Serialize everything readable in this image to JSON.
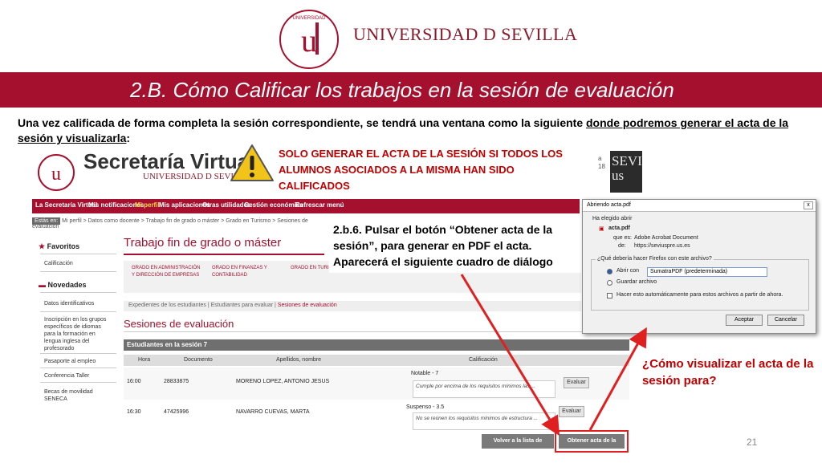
{
  "header": {
    "university_name": "UNIVERSIDAD D SEVILLA",
    "title": "2.B. Cómo Calificar los trabajos en la sesión de evaluación"
  },
  "intro": {
    "part1": "Una vez calificada de forma completa la sesión correspondiente, se tendrá una ventana como la siguiente ",
    "part2": "donde podremos generar el acta de la sesión y visualizarla",
    "part3": ":"
  },
  "secretaria": {
    "title": "Secretaría Virtual",
    "subtitle": "UNIVERSIDAD D SEVILLA"
  },
  "warning": {
    "text": "SOLO GENERAR EL ACTA DE LA SESIÓN SI TODOS LOS ALUMNOS ASOCIADOS A LA MISMA HAN SIDO CALIFICADOS"
  },
  "sevi": {
    "line1": "SEVI",
    "line2": "us",
    "side1": "a",
    "side2": "18"
  },
  "nav": {
    "items": [
      "La Secretaría Virtual",
      "Mis notificaciones",
      "Mi perfil",
      "Mis aplicaciones",
      "Otras utilidades",
      "Gestión económica",
      "Refrescar menú"
    ]
  },
  "breadcrumb": {
    "here": "Estás en:",
    "path": "Mi perfil > Datos como docente > Trabajo fin de grado o máster > Grado en Turismo > Sesiones de evaluación"
  },
  "sidebar": {
    "favoritos": "Favoritos",
    "calificacion": "Calificación",
    "novedades": "Novedades",
    "items": [
      "Datos identificativos",
      "Inscripción en los grupos específicos de idiomas para la formación en lengua inglesa del profesorado",
      "Pasaporte al empleo",
      "Conferencia Taller",
      "Becas de movilidad SENECA"
    ]
  },
  "main": {
    "title": "Trabajo fin de grado o máster",
    "grades": [
      "GRADO EN ADMINISTRACIÓN Y DIRECCIÓN DE EMPRESAS",
      "GRADO EN FINANZAS Y CONTABILIDAD",
      "GRADO EN TURIS"
    ],
    "tabs": {
      "t1": "Expedientes de los estudiantes",
      "t2": "Estudiantes para evaluar",
      "t3": "Sesiones de evaluación"
    },
    "sessions_title": "Sesiones de evaluación",
    "table_title": "Estudiantes en la sesión 7",
    "columns": [
      "Hora",
      "Documento",
      "Apellidos, nombre",
      "Calificación"
    ],
    "rows": [
      {
        "hora": "16:00",
        "documento": "28833875",
        "nombre": "MORENO LOPEZ, ANTONIO JESUS",
        "nota": "Notable - 7",
        "comentario": "Cumple por encima de los requisitos mínimos las ...",
        "boton": "Evaluar"
      },
      {
        "hora": "16:30",
        "documento": "47425996",
        "nombre": "NAVARRO CUEVAS, MARTA",
        "nota": "Suspenso - 3.5",
        "comentario": "No se reúnen los requisitos mínimos de estructura ...",
        "boton": "Evaluar"
      }
    ],
    "btn_back": "Volver a la lista de sesiones",
    "btn_acta": "Obtener acta de la sesión"
  },
  "step": {
    "text": "2.b.6. Pulsar el botón “Obtener acta de la sesión”, para generar en PDF el acta. Aparecerá el siguiente cuadro de diálogo"
  },
  "dialog": {
    "title": "Abriendo acta.pdf",
    "close": "x",
    "chosen": "Ha elegido abrir",
    "filename": "acta.pdf",
    "type_label": "que es:",
    "type_value": "Adobe Acrobat Document",
    "from_label": "de:",
    "from_value": "https://seviuspre.us.es",
    "question": "¿Qué debería hacer Firefox con este archivo?",
    "open_with": "Abrir con",
    "app": "SumatraPDF (predeterminada)",
    "save": "Guardar archivo",
    "auto": "Hacer esto automáticamente para estos archivos a partir de ahora.",
    "accept": "Aceptar",
    "cancel": "Cancelar"
  },
  "question": "¿Cómo visualizar el acta de la sesión para?",
  "page_number": "21",
  "colors": {
    "brand": "#a5102e",
    "warning_text": "#c00000",
    "arrow": "#e02020"
  }
}
